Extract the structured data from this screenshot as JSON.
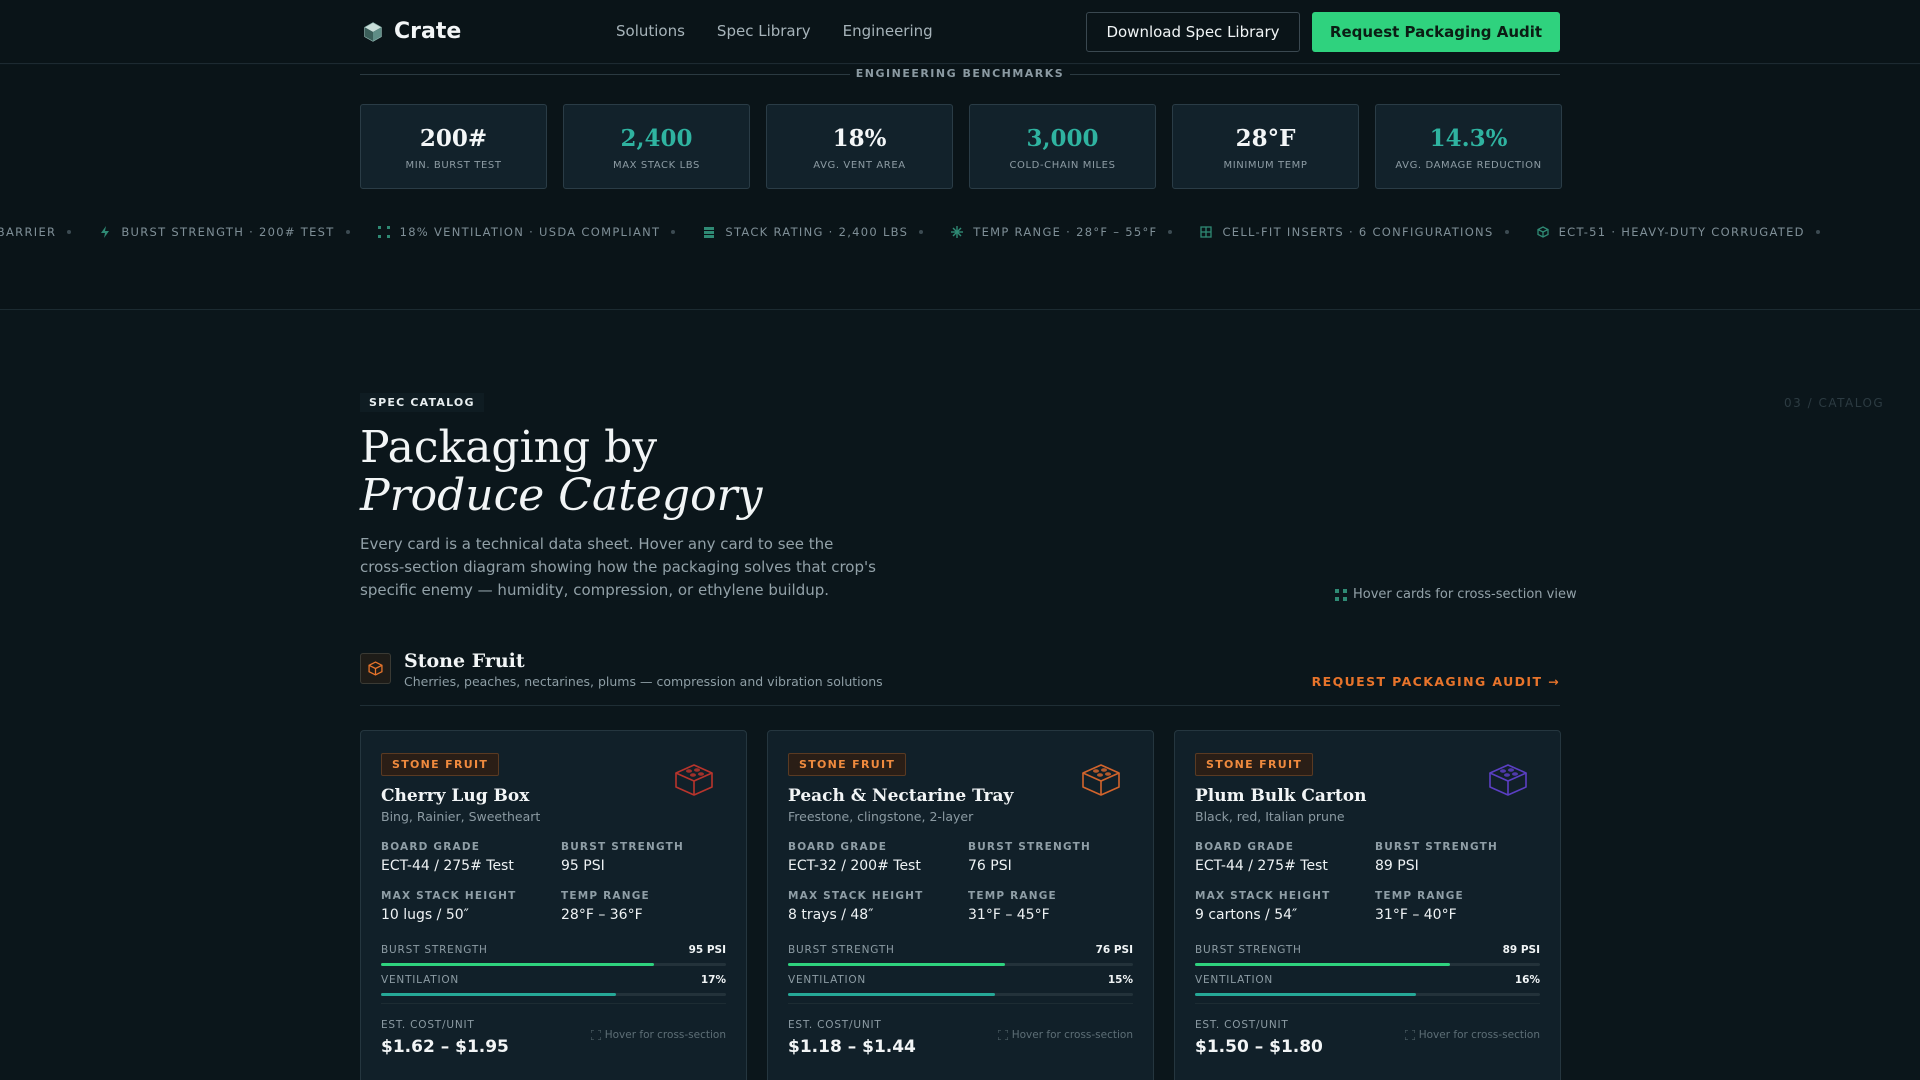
{
  "nav": {
    "brand": "Crate",
    "links": [
      "Solutions",
      "Spec Library",
      "Engineering"
    ],
    "download_label": "Download Spec Library",
    "audit_label": "Request Packaging Audit"
  },
  "benchmarks": {
    "title": "ENGINEERING BENCHMARKS",
    "items": [
      {
        "value": "200#",
        "label": "MIN. BURST TEST"
      },
      {
        "value": "2,400",
        "label": "MAX STACK LBS"
      },
      {
        "value": "18%",
        "label": "AVG. VENT AREA"
      },
      {
        "value": "3,000",
        "label": "COLD-CHAIN MILES"
      },
      {
        "value": "28°F",
        "label": "MINIMUM TEMP"
      },
      {
        "value": "14.3%",
        "label": "AVG. DAMAGE REDUCTION"
      }
    ],
    "accent_color": "#2fb3a0"
  },
  "ticker": [
    {
      "text": "RE BARRIER",
      "icon": "none"
    },
    {
      "text": "BURST STRENGTH · 200# TEST",
      "icon": "bolt-icon"
    },
    {
      "text": "18% VENTILATION · USDA COMPLIANT",
      "icon": "vent-icon"
    },
    {
      "text": "STACK RATING · 2,400 LBS",
      "icon": "stack-icon"
    },
    {
      "text": "TEMP RANGE · 28°F – 55°F",
      "icon": "snowflake-icon"
    },
    {
      "text": "CELL-FIT INSERTS · 6 CONFIGURATIONS",
      "icon": "grid-icon"
    },
    {
      "text": "ECT-51 · HEAVY-DUTY CORRUGATED",
      "icon": "box-icon"
    }
  ],
  "catalog": {
    "eyebrow": "SPEC CATALOG",
    "section_number": "03 / CATALOG",
    "headline_line1": "Packaging by",
    "headline_line2": "Produce Category",
    "intro": "Every card is a technical data sheet. Hover any card to see the cross-section diagram showing how the packaging solves that crop's specific enemy — humidity, compression, or ethylene buildup.",
    "hover_hint": "Hover cards for cross-section view",
    "category": {
      "title": "Stone Fruit",
      "subtitle": "Cherries, peaches, nectarines, plums — compression and vibration solutions",
      "cta": "REQUEST PACKAGING AUDIT →"
    },
    "spec_labels": {
      "board_grade": "BOARD GRADE",
      "burst_strength": "BURST STRENGTH",
      "max_stack": "MAX STACK HEIGHT",
      "temp_range": "TEMP RANGE",
      "bar_burst": "BURST STRENGTH",
      "bar_vent": "VENTILATION",
      "cost": "EST. COST/UNIT",
      "card_hint": "Hover for cross-section"
    },
    "cards": [
      {
        "tag": "STONE FRUIT",
        "title": "Cherry Lug Box",
        "subtitle": "Bing, Rainier, Sweetheart",
        "board_grade": "ECT-44 / 275# Test",
        "burst_strength": "95 PSI",
        "max_stack": "10 lugs / 50″",
        "temp_range": "28°F – 36°F",
        "burst_display": "95 PSI",
        "burst_fraction": 0.79,
        "vent_display": "17%",
        "vent_fraction": 0.68,
        "cost": "$1.62 – $1.95",
        "icon_color": "#b8342c"
      },
      {
        "tag": "STONE FRUIT",
        "title": "Peach & Nectarine Tray",
        "subtitle": "Freestone, clingstone, 2-layer",
        "board_grade": "ECT-32 / 200# Test",
        "burst_strength": "76 PSI",
        "max_stack": "8 trays / 48″",
        "temp_range": "31°F – 45°F",
        "burst_display": "76 PSI",
        "burst_fraction": 0.63,
        "vent_display": "15%",
        "vent_fraction": 0.6,
        "cost": "$1.18 – $1.44",
        "icon_color": "#d2642c"
      },
      {
        "tag": "STONE FRUIT",
        "title": "Plum Bulk Carton",
        "subtitle": "Black, red, Italian prune",
        "board_grade": "ECT-44 / 275# Test",
        "burst_strength": "89 PSI",
        "max_stack": "9 cartons / 54″",
        "temp_range": "31°F – 40°F",
        "burst_display": "89 PSI",
        "burst_fraction": 0.74,
        "vent_display": "16%",
        "vent_fraction": 0.64,
        "cost": "$1.50 – $1.80",
        "icon_color": "#5b3fc4"
      }
    ]
  }
}
